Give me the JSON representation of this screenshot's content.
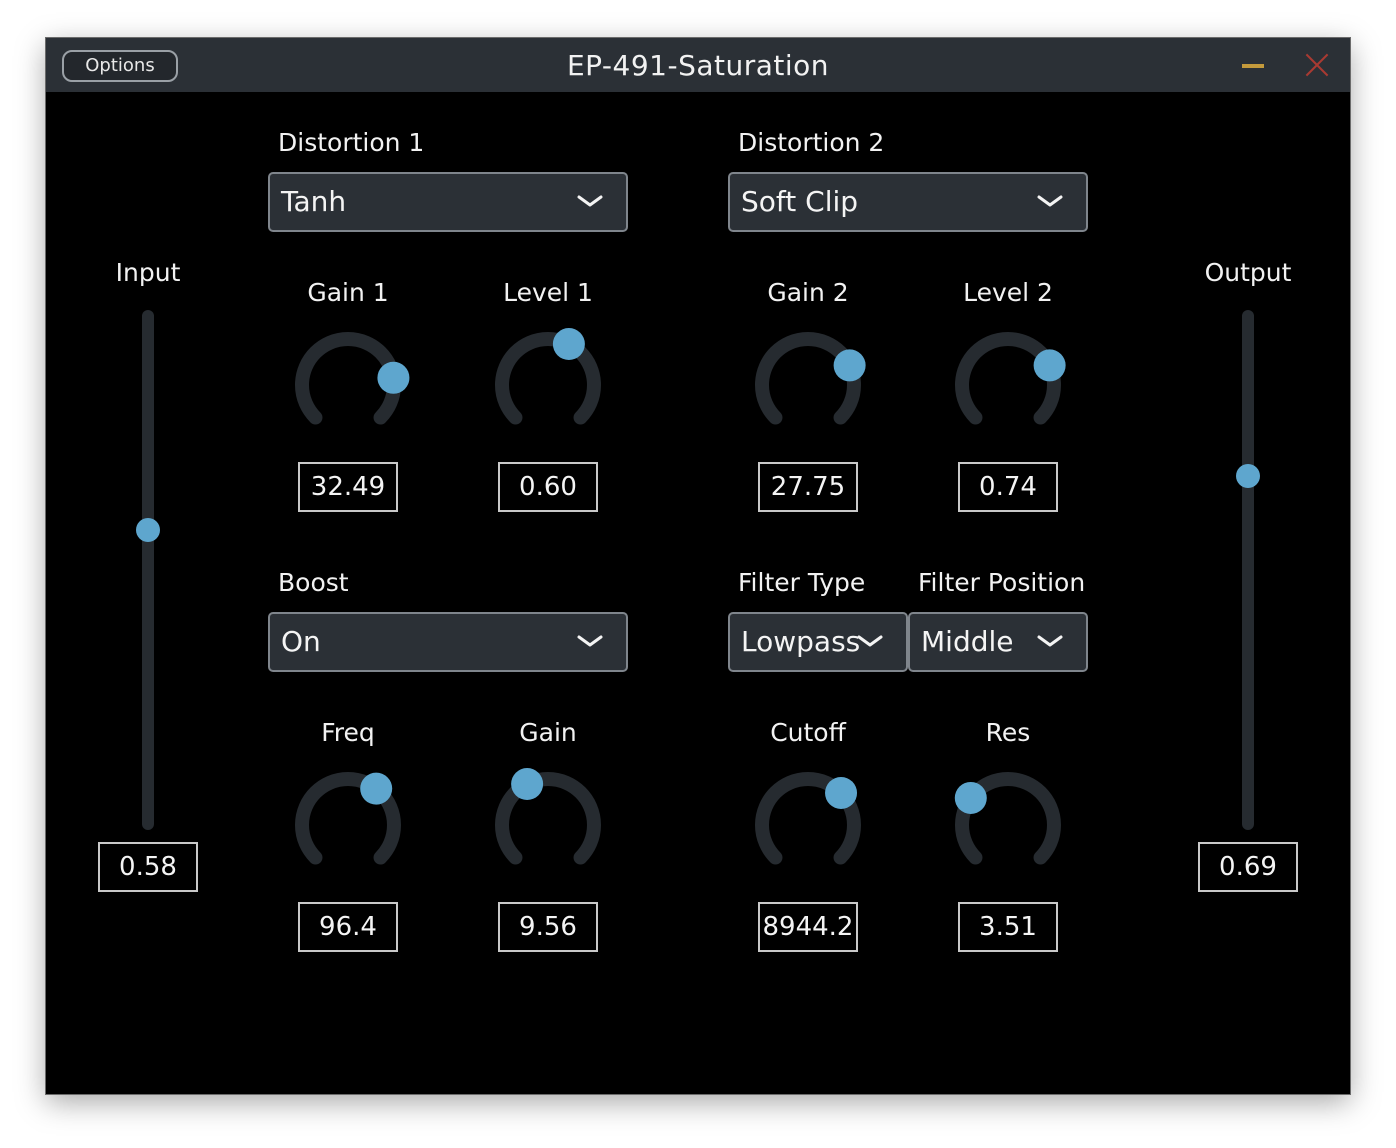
{
  "window": {
    "title": "EP-491-Saturation",
    "options_label": "Options"
  },
  "input": {
    "label": "Input",
    "value": "0.58",
    "level": 0.58
  },
  "output": {
    "label": "Output",
    "value": "0.69",
    "level": 0.69
  },
  "distortion1": {
    "label": "Distortion 1",
    "selected": "Tanh",
    "gain": {
      "label": "Gain 1",
      "value": "32.49",
      "position": 0.8
    },
    "level": {
      "label": "Level 1",
      "value": "0.60",
      "position": 0.6
    }
  },
  "distortion2": {
    "label": "Distortion 2",
    "selected": "Soft Clip",
    "gain": {
      "label": "Gain 2",
      "value": "27.75",
      "position": 0.74
    },
    "level": {
      "label": "Level 2",
      "value": "0.74",
      "position": 0.74
    }
  },
  "boost": {
    "label": "Boost",
    "selected": "On",
    "freq": {
      "label": "Freq",
      "value": "96.4",
      "position": 0.64
    },
    "gain": {
      "label": "Gain",
      "value": "9.56",
      "position": 0.4
    }
  },
  "filter": {
    "type_label": "Filter Type",
    "type_selected": "Lowpass",
    "position_label": "Filter Position",
    "position_selected": "Middle",
    "cutoff": {
      "label": "Cutoff",
      "value": "8944.2",
      "position": 0.67
    },
    "res": {
      "label": "Res",
      "value": "3.51",
      "position": 0.3
    }
  },
  "colors": {
    "accent": "#5ea6ce",
    "knob_track": "#262b30",
    "panel_bg": "#000000",
    "titlebar_bg": "#2b3036",
    "combo_bg": "#2b3036",
    "minimize": "#c49a3c",
    "close": "#a93a32"
  },
  "icons": {
    "close": "close-icon",
    "minimize": "minimize-icon",
    "dropdown": "chevron-down-icon"
  }
}
